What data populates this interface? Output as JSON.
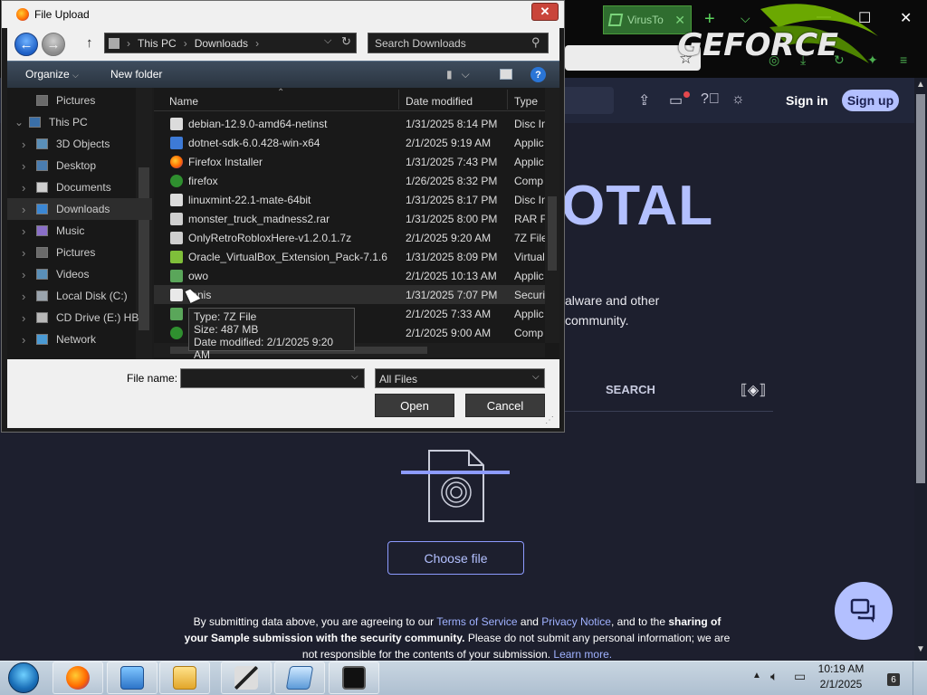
{
  "browser": {
    "tab_label": "VirusTo",
    "geforce_text": "GEFORCE",
    "header": {
      "sign_in": "Sign in",
      "sign_up": "Sign up"
    },
    "logo_text": "OTAL",
    "tagline_line1": "alware and other",
    "tagline_line2": "community.",
    "tab_search": "SEARCH",
    "choose_file": "Choose file",
    "disclaimer": {
      "p1": "By submitting data above, you are agreeing to our ",
      "tos": "Terms of Service",
      "and": " and ",
      "privacy": "Privacy Notice",
      "p2": ", and to the ",
      "bold1": "sharing of your Sample submission with the security community.",
      "p3": " Please do not submit any personal information; we are not responsible for the contents of your submission. ",
      "learn_more": "Learn more."
    },
    "colors": {
      "accent": "#b3c0ff",
      "background": "#1d1f2e",
      "link": "#9fb1ff"
    }
  },
  "dialog": {
    "title": "File Upload",
    "breadcrumb": [
      "This PC",
      "Downloads"
    ],
    "search_placeholder": "Search Downloads",
    "toolbar": {
      "organize": "Organize",
      "new_folder": "New folder"
    },
    "nav": [
      {
        "label": "Pictures",
        "icon": "pictures-icon",
        "expandable": false
      },
      {
        "label": "This PC",
        "icon": "pc-icon",
        "expandable": true
      },
      {
        "label": "3D Objects",
        "icon": "3d-objects-icon",
        "expandable": true
      },
      {
        "label": "Desktop",
        "icon": "desktop-icon",
        "expandable": true
      },
      {
        "label": "Documents",
        "icon": "documents-icon",
        "expandable": true
      },
      {
        "label": "Downloads",
        "icon": "downloads-icon",
        "expandable": true,
        "selected": true
      },
      {
        "label": "Music",
        "icon": "music-icon",
        "expandable": true
      },
      {
        "label": "Pictures",
        "icon": "pictures-icon",
        "expandable": true
      },
      {
        "label": "Videos",
        "icon": "videos-icon",
        "expandable": true
      },
      {
        "label": "Local Disk (C:)",
        "icon": "disk-icon",
        "expandable": true
      },
      {
        "label": "CD Drive (E:) HB",
        "icon": "cd-icon",
        "expandable": true
      },
      {
        "label": "Network",
        "icon": "network-icon",
        "expandable": true
      }
    ],
    "columns": {
      "name": "Name",
      "date": "Date modified",
      "type": "Type"
    },
    "files": [
      {
        "name": "debian-12.9.0-amd64-netinst",
        "date": "1/31/2025 8:14 PM",
        "type": "Disc In",
        "icon": "disc-image-icon"
      },
      {
        "name": "dotnet-sdk-6.0.428-win-x64",
        "date": "2/1/2025 9:19 AM",
        "type": "Applic",
        "icon": "installer-icon"
      },
      {
        "name": "Firefox Installer",
        "date": "1/31/2025 7:43 PM",
        "type": "Applic",
        "icon": "firefox-icon"
      },
      {
        "name": "firefox",
        "date": "1/26/2025 8:32 PM",
        "type": "Comp",
        "icon": "compressed-icon"
      },
      {
        "name": "linuxmint-22.1-mate-64bit",
        "date": "1/31/2025 8:17 PM",
        "type": "Disc In",
        "icon": "disc-image-icon"
      },
      {
        "name": "monster_truck_madness2.rar",
        "date": "1/31/2025 8:00 PM",
        "type": "RAR Fi",
        "icon": "archive-icon"
      },
      {
        "name": "OnlyRetroRobloxHere-v1.2.0.1.7z",
        "date": "2/1/2025 9:20 AM",
        "type": "7Z File",
        "icon": "archive-icon"
      },
      {
        "name": "Oracle_VirtualBox_Extension_Pack-7.1.6",
        "date": "1/31/2025 8:09 PM",
        "type": "Virtual",
        "icon": "virtualbox-icon"
      },
      {
        "name": "owo",
        "date": "2/1/2025 10:13 AM",
        "type": "Applic",
        "icon": "app-icon"
      },
      {
        "name": "tanis",
        "date": "1/31/2025 7:07 PM",
        "type": "Securit",
        "icon": "certificate-icon",
        "hover": true
      },
      {
        "name": "",
        "date": "2/1/2025 7:33 AM",
        "type": "Applic",
        "icon": "app-icon"
      },
      {
        "name": "",
        "date": "2/1/2025 9:00 AM",
        "type": "Comp",
        "icon": "compressed-icon"
      }
    ],
    "tooltip": {
      "type": "Type: 7Z File",
      "size": "Size: 487 MB",
      "date": "Date modified: 2/1/2025 9:20 AM"
    },
    "file_name_label": "File name:",
    "file_name_value": "",
    "filter": "All Files",
    "open": "Open",
    "cancel": "Cancel"
  },
  "taskbar": {
    "time": "10:19 AM",
    "date": "2/1/2025",
    "notifications": "6",
    "apps": [
      "firefox-icon",
      "computer-icon",
      "file-explorer-icon",
      "paint-icon",
      "virtualbox-icon",
      "terminal-icon"
    ]
  }
}
